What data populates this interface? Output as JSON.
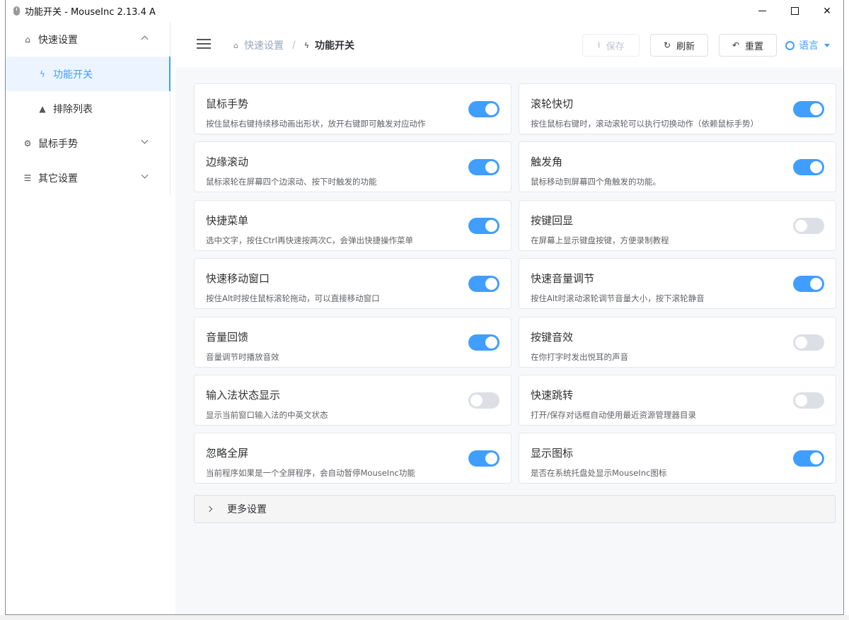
{
  "window": {
    "title": "功能开关 - MouseInc 2.13.4 A"
  },
  "sidebar": {
    "items": [
      {
        "label": "快速设置",
        "icon": "home-icon"
      },
      {
        "label": "功能开关",
        "icon": "bolt-icon"
      },
      {
        "label": "排除列表",
        "icon": "warning-icon"
      },
      {
        "label": "鼠标手势",
        "icon": "gear-icon"
      },
      {
        "label": "其它设置",
        "icon": "sliders-icon"
      }
    ]
  },
  "header": {
    "breadcrumb": {
      "home": "快速设置",
      "current": "功能开关"
    },
    "save_label": "保存",
    "refresh_label": "刷新",
    "reset_label": "重置",
    "language_label": "语言"
  },
  "features": [
    {
      "title": "鼠标手势",
      "desc": "按住鼠标右键持续移动画出形状，放开右键即可触发对应动作",
      "enabled": true
    },
    {
      "title": "滚轮快切",
      "desc": "按住鼠标右键时，滚动滚轮可以执行切换动作（依赖鼠标手势）",
      "enabled": true
    },
    {
      "title": "边缘滚动",
      "desc": "鼠标滚轮在屏幕四个边滚动、按下时触发的功能",
      "enabled": true
    },
    {
      "title": "触发角",
      "desc": "鼠标移动到屏幕四个角触发的功能。",
      "enabled": true
    },
    {
      "title": "快捷菜单",
      "desc": "选中文字，按住Ctrl再快速按两次C，会弹出快捷操作菜单",
      "enabled": true
    },
    {
      "title": "按键回显",
      "desc": "在屏幕上显示键盘按键，方便录制教程",
      "enabled": false
    },
    {
      "title": "快速移动窗口",
      "desc": "按住Alt时按住鼠标滚轮拖动，可以直接移动窗口",
      "enabled": true
    },
    {
      "title": "快速音量调节",
      "desc": "按住Alt时滚动滚轮调节音量大小，按下滚轮静音",
      "enabled": true
    },
    {
      "title": "音量回馈",
      "desc": "音量调节时播放音效",
      "enabled": true
    },
    {
      "title": "按键音效",
      "desc": "在你打字时发出悦耳的声音",
      "enabled": false
    },
    {
      "title": "输入法状态显示",
      "desc": "显示当前窗口输入法的中英文状态",
      "enabled": false
    },
    {
      "title": "快速跳转",
      "desc": "打开/保存对话框自动使用最近资源管理器目录",
      "enabled": false
    },
    {
      "title": "忽略全屏",
      "desc": "当前程序如果是一个全屏程序，会自动暂停MouseInc功能",
      "enabled": true
    },
    {
      "title": "显示图标",
      "desc": "是否在系统托盘处显示MouseInc图标",
      "enabled": true
    }
  ],
  "more_settings": {
    "label": "更多设置"
  },
  "colors": {
    "accent": "#409eff",
    "switch_off": "#dcdfe6"
  }
}
